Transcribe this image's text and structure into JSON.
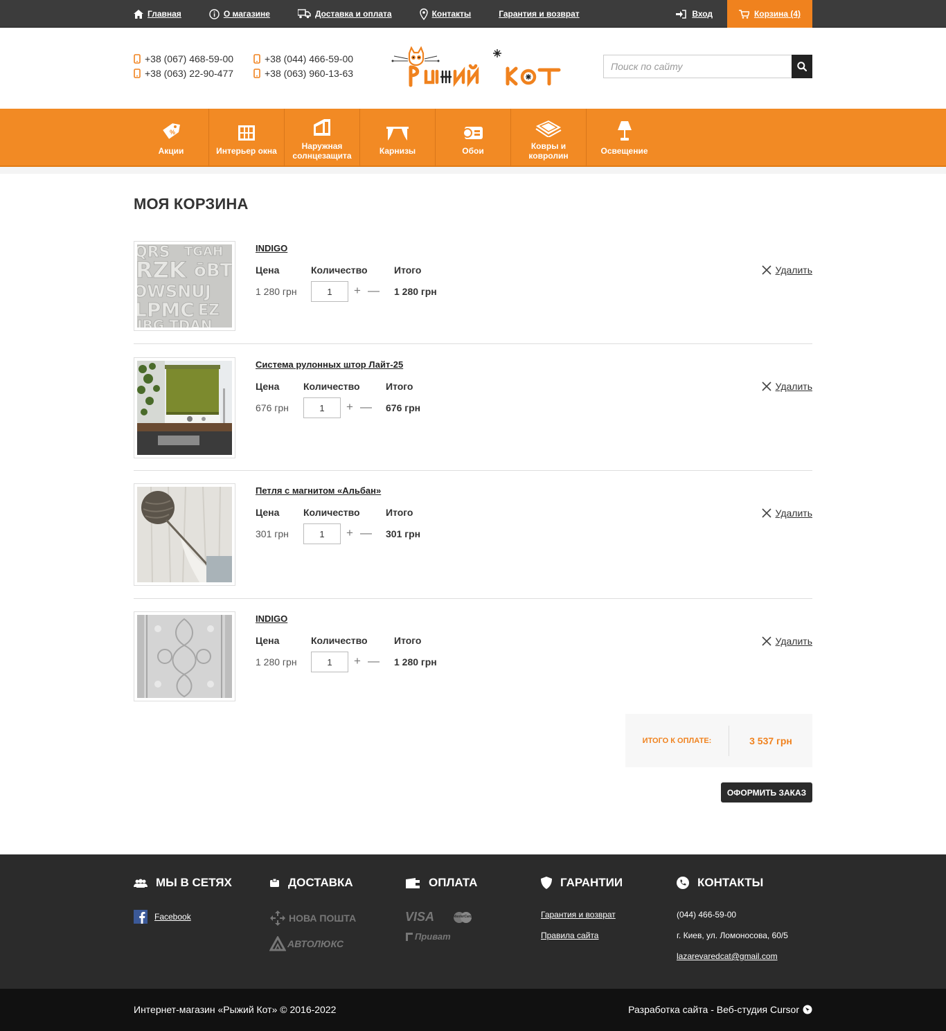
{
  "topbar": {
    "links": [
      {
        "label": "Главная",
        "icon": "home-icon"
      },
      {
        "label": "О магазине",
        "icon": "info-icon"
      },
      {
        "label": "Доставка и оплата",
        "icon": "truck-icon"
      },
      {
        "label": "Контакты",
        "icon": "map-pin-icon"
      },
      {
        "label": "Гарантия и возврат",
        "icon": ""
      }
    ],
    "login_label": "Вход",
    "cart_label": "Корзина (4)"
  },
  "header": {
    "phones": [
      "+38 (067) 468-59-00",
      "+38 (044) 466-59-00",
      "+38 (063) 22-90-477",
      "+38 (063) 960-13-63"
    ],
    "logo_text": "Рыжий Кот",
    "search_placeholder": "Поиск по сайту"
  },
  "categories": [
    {
      "label": "Акции",
      "icon": "sale-tag-icon"
    },
    {
      "label": "Интерьер окна",
      "icon": "window-icon"
    },
    {
      "label": "Наружная солнцезащита",
      "icon": "awning-icon"
    },
    {
      "label": "Карнизы",
      "icon": "curtain-rod-icon"
    },
    {
      "label": "Обои",
      "icon": "wallpaper-roll-icon"
    },
    {
      "label": "Ковры и ковролин",
      "icon": "carpet-icon"
    },
    {
      "label": "Освещение",
      "icon": "lamp-icon"
    }
  ],
  "page_title": "МОЯ КОРЗИНА",
  "cart": {
    "labels": {
      "price": "Цена",
      "quantity": "Количество",
      "total": "Итого",
      "delete": "Удалить",
      "plus": "+",
      "minus": "—"
    },
    "items": [
      {
        "name": "INDIGO",
        "price": "1 280 грн",
        "qty": "1",
        "total": "1 280 грн"
      },
      {
        "name": "Система рулонных штор Лайт-25",
        "price": "676 грн",
        "qty": "1",
        "total": "676 грн"
      },
      {
        "name": "Петля с магнитом «Альбан»",
        "price": "301 грн",
        "qty": "1",
        "total": "301 грн"
      },
      {
        "name": "INDIGO",
        "price": "1 280 грн",
        "qty": "1",
        "total": "1 280 грн"
      }
    ],
    "summary_label": "ИТОГО К ОПЛАТЕ:",
    "summary_value": "3 537 грн",
    "order_button": "ОФОРМИТЬ ЗАКАЗ"
  },
  "footer": {
    "social": {
      "title": "МЫ В СЕТЯХ",
      "facebook": "Facebook"
    },
    "delivery": {
      "title": "ДОСТАВКА",
      "carriers": [
        "НОВА ПОШТА",
        "АВТОЛЮКС"
      ]
    },
    "payment": {
      "title": "ОПЛАТА",
      "methods": [
        "VISA",
        "MasterCard",
        "Приват"
      ]
    },
    "guarantee": {
      "title": "ГАРАНТИИ",
      "links": [
        "Гарантия и возврат",
        "Правила сайта"
      ]
    },
    "contacts": {
      "title": "КОНТАКТЫ",
      "phone": "(044) 466-59-00",
      "address": "г. Киев, ул. Ломоносова, 60/5",
      "email": "lazarevaredcat@gmail.com"
    },
    "copyright": "Интернет-магазин «Рыжий Кот» © 2016-2022",
    "developer": "Разработка сайта - Веб-студия Cursor"
  },
  "colors": {
    "accent": "#f0821e",
    "dark": "#3c3c3c",
    "footer": "#2b2b2b"
  }
}
